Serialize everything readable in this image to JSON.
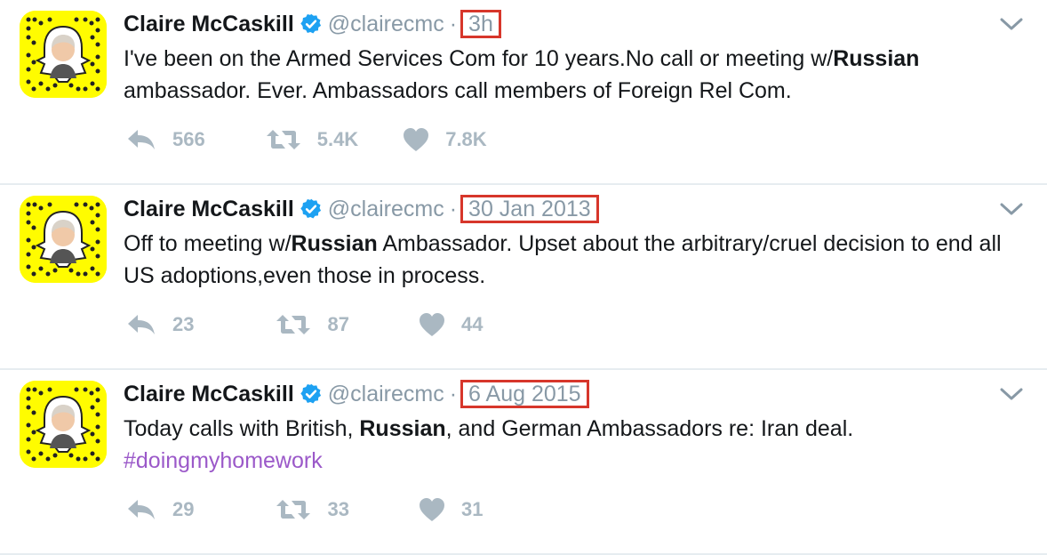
{
  "tweets": [
    {
      "name": "Claire McCaskill",
      "handle": "@clairecmc",
      "dot": "·",
      "time": "3h",
      "text_parts": [
        "I've been on the Armed Services Com for 10 years.No call or meeting w/",
        "Russian",
        " ambassador. Ever. Ambassadors call members of Foreign Rel Com."
      ],
      "replies": "566",
      "retweets": "5.4K",
      "likes": "7.8K"
    },
    {
      "name": "Claire McCaskill",
      "handle": "@clairecmc",
      "dot": "·",
      "time": "30 Jan 2013",
      "text_parts": [
        "Off to meeting w/",
        "Russian",
        " Ambassador. Upset about the arbitrary/cruel decision to end all US adoptions,even those in process."
      ],
      "replies": "23",
      "retweets": "87",
      "likes": "44"
    },
    {
      "name": "Claire McCaskill",
      "handle": "@clairecmc",
      "dot": "·",
      "time": "6 Aug 2015",
      "text_parts": [
        "Today calls with British, ",
        "Russian",
        ", and German Ambassadors re: Iran deal."
      ],
      "hashtag": "#doingmyhomework",
      "replies": "29",
      "retweets": "33",
      "likes": "31"
    }
  ],
  "icons": {
    "avatar": "snapcode-avatar",
    "verified": "verified-badge-icon",
    "reply": "reply-icon",
    "retweet": "retweet-icon",
    "like": "heart-icon",
    "more": "chevron-down-icon"
  },
  "colors": {
    "highlight_box": "#d7362b",
    "snapchat_yellow": "#fffc00",
    "verified_blue": "#1da1f2",
    "hashtag": "#9b59c9",
    "muted": "#8899a6"
  }
}
